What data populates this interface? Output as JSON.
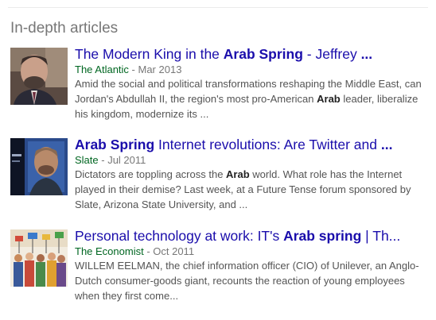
{
  "section": {
    "title": "In-depth articles"
  },
  "articles": [
    {
      "title_parts": [
        {
          "text": "The Modern King in the ",
          "bold": false
        },
        {
          "text": "Arab Spring",
          "bold": true
        },
        {
          "text": " - Jeffrey ",
          "bold": false
        },
        {
          "text": "...",
          "bold": true
        }
      ],
      "source": "The Atlantic",
      "separator": " - ",
      "date": "Mar 2013",
      "snippet_parts": [
        {
          "text": "Amid the social and political transformations reshaping the Middle East, can Jordan's Abdullah II, the region's most pro-American ",
          "bold": false
        },
        {
          "text": "Arab",
          "bold": true
        },
        {
          "text": " leader, liberalize his kingdom, modernize its ...",
          "bold": false
        }
      ],
      "thumbnail_icon": "portrait-photo-icon"
    },
    {
      "title_parts": [
        {
          "text": "Arab Spring",
          "bold": true
        },
        {
          "text": " Internet revolutions: Are Twitter and ",
          "bold": false
        },
        {
          "text": "...",
          "bold": true
        }
      ],
      "source": "Slate",
      "separator": " - ",
      "date": "Jul 2011",
      "snippet_parts": [
        {
          "text": "Dictators are toppling across the ",
          "bold": false
        },
        {
          "text": "Arab",
          "bold": true
        },
        {
          "text": " world. What role has the Internet played in their demise? Last week, at a Future Tense forum sponsored by Slate, Arizona State University, and ...",
          "bold": false
        }
      ],
      "thumbnail_icon": "video-screen-photo-icon"
    },
    {
      "title_parts": [
        {
          "text": "Personal technology at work: IT's ",
          "bold": false
        },
        {
          "text": "Arab spring",
          "bold": true
        },
        {
          "text": " | Th...",
          "bold": false
        }
      ],
      "source": "The Economist",
      "separator": " - ",
      "date": "Oct 2011",
      "snippet_parts": [
        {
          "text": "WILLEM EELMAN, the chief information officer (CIO) of Unilever, an Anglo-Dutch consumer-goods giant, recounts the reaction of young employees when they first come...",
          "bold": false
        }
      ],
      "thumbnail_icon": "crowd-illustration-icon"
    }
  ],
  "colors": {
    "link": "#1a0dab",
    "source": "#006621",
    "muted": "#777777",
    "snippet": "#545454"
  }
}
